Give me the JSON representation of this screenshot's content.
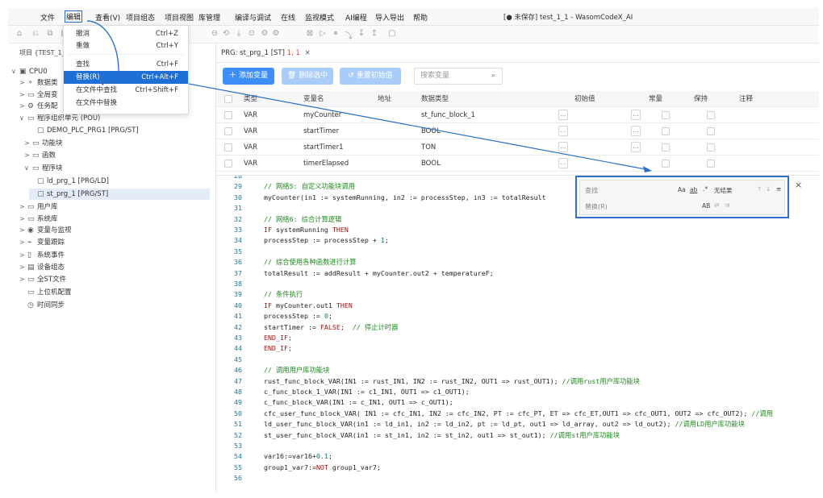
{
  "menubar": {
    "items": [
      "文件",
      "编辑",
      "查看(V)",
      "项目组态",
      "项目视图",
      "库管理",
      "编译与调试",
      "在线",
      "监视模式",
      "AI编程",
      "导入导出",
      "帮助"
    ],
    "title": "[● 未保存] test_1_1 - WasomCodeX_AI"
  },
  "toolbar": {
    "icons": [
      "home-icon",
      "undo-icon",
      "copy-icon",
      "grid-icon",
      "build-icon",
      "download-icon",
      "monitor-icon",
      "settings-icon",
      "settings2-icon",
      "debug-icon",
      "run-icon",
      "pause-icon",
      "step-icon",
      "step-into-icon",
      "step-out-icon",
      "stop-icon",
      "close-icon"
    ]
  },
  "sidebar": {
    "header": "项目 {TEST_1_1",
    "items": [
      {
        "label": "CPU0",
        "chev": "∨",
        "icon": "▣"
      },
      {
        "label": "数据类",
        "chev": ">",
        "icon": "⚬"
      },
      {
        "label": "全局变",
        "chev": ">",
        "icon": "▭"
      },
      {
        "label": "任务配",
        "chev": ">",
        "icon": "⚙"
      },
      {
        "label": "程序组织单元 (POU)",
        "chev": "∨",
        "icon": "▭"
      },
      {
        "label": "DEMO_PLC_PRG1 [PRG/ST]",
        "chev": "",
        "icon": "▢"
      },
      {
        "label": "功能块",
        "chev": ">",
        "icon": "▭"
      },
      {
        "label": "函数",
        "chev": ">",
        "icon": "▭"
      },
      {
        "label": "程序块",
        "chev": "∨",
        "icon": "▭"
      },
      {
        "label": "ld_prg_1 [PRG/LD]",
        "chev": "",
        "icon": "▢"
      },
      {
        "label": "st_prg_1 [PRG/ST]",
        "chev": "",
        "icon": "▢"
      },
      {
        "label": "用户库",
        "chev": ">",
        "icon": "▭"
      },
      {
        "label": "系统库",
        "chev": ">",
        "icon": "▭"
      },
      {
        "label": "变量与监视",
        "chev": ">",
        "icon": "◉"
      },
      {
        "label": "变量跟踪",
        "chev": ">",
        "icon": "⌁"
      },
      {
        "label": "系统事件",
        "chev": ">",
        "icon": "▯"
      },
      {
        "label": "设备组态",
        "chev": ">",
        "icon": "▤"
      },
      {
        "label": "全ST文件",
        "chev": ">",
        "icon": "▭"
      },
      {
        "label": "上位机配置",
        "chev": "",
        "icon": "▭"
      },
      {
        "label": "时间同步",
        "chev": "",
        "icon": "◷"
      }
    ]
  },
  "tab": {
    "label": "PRG: st_prg_1 [ST]",
    "pos": "1, 1",
    "close": "×"
  },
  "actions": {
    "add": "添加变量",
    "delete": "删除选中",
    "reset": "重置初始值",
    "search_placeholder": "搜索变量"
  },
  "grid": {
    "headers": [
      "类型",
      "变量名",
      "地址",
      "数据类型",
      "初始值",
      "常量",
      "保持",
      "注释"
    ],
    "rows": [
      {
        "type": "VAR",
        "name": "myCounter",
        "addr": "",
        "dtype": "st_func_block_1",
        "init": ""
      },
      {
        "type": "VAR",
        "name": "startTimer",
        "addr": "",
        "dtype": "BOOL",
        "init": ""
      },
      {
        "type": "VAR",
        "name": "startTimer1",
        "addr": "",
        "dtype": "TON",
        "init": ""
      },
      {
        "type": "VAR",
        "name": "timerElapsed",
        "addr": "",
        "dtype": "BOOL",
        "init": ""
      }
    ]
  },
  "dropdown": {
    "items": [
      {
        "label": "撤消",
        "shortcut": "Ctrl+Z"
      },
      {
        "label": "重做",
        "shortcut": "Ctrl+Y"
      },
      {
        "label": "查找",
        "shortcut": "Ctrl+F"
      },
      {
        "label": "替换(R)",
        "shortcut": "Ctrl+Alt+F"
      },
      {
        "label": "在文件中查找",
        "shortcut": "Ctrl+Shift+F"
      },
      {
        "label": "在文件中替换",
        "shortcut": ""
      }
    ]
  },
  "find": {
    "find_placeholder": "查找",
    "replace_placeholder": "替换(R)",
    "no_results": "无结果",
    "opt_case": "Aa",
    "opt_word": "ab",
    "opt_regex": ".*",
    "opt_preserve": "AB"
  },
  "code": [
    {
      "n": "28",
      "t": ""
    },
    {
      "n": "29",
      "t": "// 网络5: 自定义功能块调用",
      "c": "cm"
    },
    {
      "n": "30",
      "t": "myCounter(in1 := systemRunning, in2 := processStep, in3 := totalResult"
    },
    {
      "n": "31",
      "t": ""
    },
    {
      "n": "32",
      "t": "// 网络6: 综合计算逻辑",
      "c": "cm"
    },
    {
      "n": "33",
      "t": "IF systemRunning THEN",
      "c": "if"
    },
    {
      "n": "34",
      "t": "processStep := processStep + 1;",
      "c": "num"
    },
    {
      "n": "35",
      "t": ""
    },
    {
      "n": "36",
      "t": "// 综合使用各种函数进行计算",
      "c": "cm"
    },
    {
      "n": "37",
      "t": "totalResult := addResult + myCounter.out2 + temperatureF;"
    },
    {
      "n": "38",
      "t": ""
    },
    {
      "n": "39",
      "t": "// 条件执行",
      "c": "cm"
    },
    {
      "n": "40",
      "t": "IF myCounter.out1 THEN",
      "c": "if"
    },
    {
      "n": "41",
      "t": "processStep := 0;",
      "c": "num"
    },
    {
      "n": "42",
      "t": "startTimer := FALSE;  // 停止计时器",
      "c": "false"
    },
    {
      "n": "43",
      "t": "END_IF;",
      "c": "kw"
    },
    {
      "n": "44",
      "t": "END_IF;",
      "c": "kw"
    },
    {
      "n": "45",
      "t": ""
    },
    {
      "n": "46",
      "t": "// 调用用户库功能块",
      "c": "cm"
    },
    {
      "n": "47",
      "t": "rust_func_block_VAR(IN1 := rust_IN1, IN2 := rust_IN2, OUT1 => rust_OUT1); //调用rust用户库功能块",
      "c": "tail"
    },
    {
      "n": "48",
      "t": "c_func_block_1_VAR(IN1 := c1_IN1, OUT1 => c1_OUT1);"
    },
    {
      "n": "49",
      "t": "c_func_block_VAR(IN1 := c_IN1, OUT1 => c_OUT1);"
    },
    {
      "n": "50",
      "t": "cfc_user_func_block_VAR( IN1 := cfc_IN1, IN2 := cfc_IN2, PT := cfc_PT, ET => cfc_ET,OUT1 => cfc_OUT1, OUT2 => cfc_OUT2); //调用",
      "c": "tail"
    },
    {
      "n": "51",
      "t": "ld_user_func_block_VAR(in1 := ld_in1, in2 := ld_in2, pt := ld_pt, out1 => ld_array, out2 => ld_out2); //调用LD用户库功能块",
      "c": "tail"
    },
    {
      "n": "52",
      "t": "st_user_func_block_VAR(in1 := st_in1, in2 := st_in2, out1 => st_out1); //调用st用户库功能块",
      "c": "tail"
    },
    {
      "n": "53",
      "t": ""
    },
    {
      "n": "54",
      "t": "var16:=var16+0.1;",
      "c": "num"
    },
    {
      "n": "55",
      "t": "group1_var7:=NOT group1_var7;",
      "c": "not"
    },
    {
      "n": "56",
      "t": ""
    }
  ]
}
